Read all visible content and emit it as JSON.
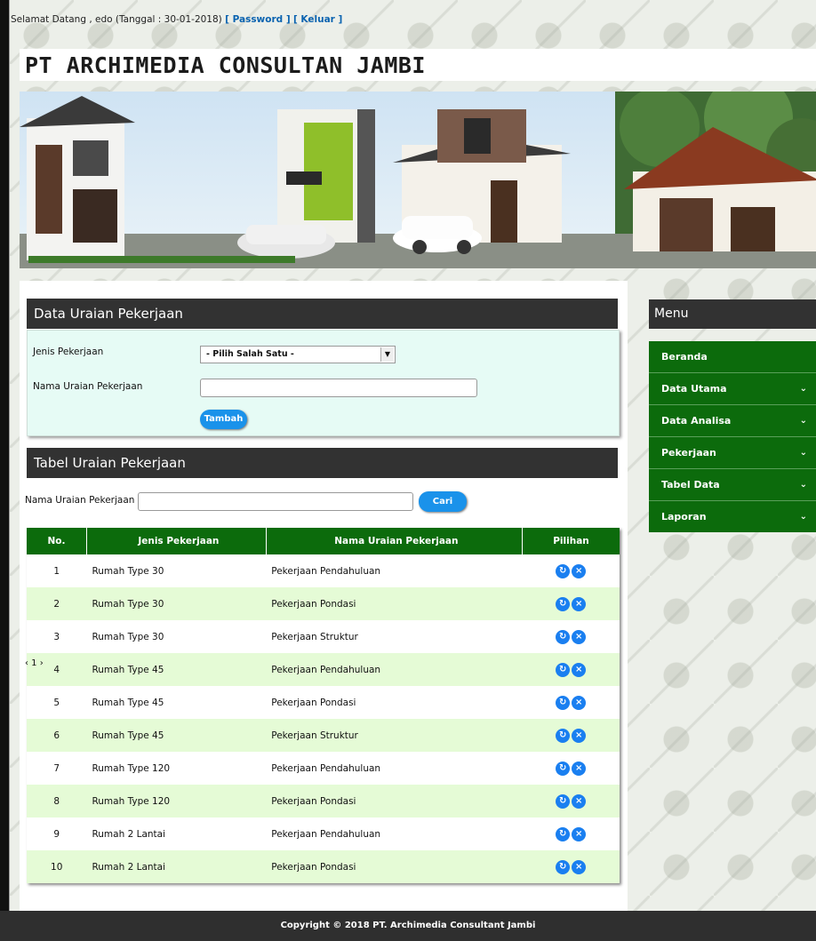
{
  "topbar": {
    "welcome": "Selamat Datang , edo (Tanggal : 30-01-2018)",
    "password_link": "[ Password ]",
    "logout_link": "[ Keluar ]"
  },
  "site_title": "PT ARCHIMEDIA CONSULTAN JAMBI",
  "form": {
    "heading": "Data Uraian Pekerjaan",
    "jenis_label": "Jenis Pekerjaan",
    "jenis_selected": "- Pilih Salah Satu -",
    "nama_label": "Nama Uraian Pekerjaan",
    "nama_value": "",
    "submit_label": "Tambah"
  },
  "table_section": {
    "heading": "Tabel Uraian Pekerjaan",
    "search_label": "Nama Uraian Pekerjaan :",
    "search_value": "",
    "search_button": "Cari",
    "columns": [
      "No.",
      "Jenis Pekerjaan",
      "Nama Uraian Pekerjaan",
      "Pilihan"
    ],
    "rows": [
      {
        "no": "1",
        "jenis": "Rumah Type 30",
        "nama": "Pekerjaan Pendahuluan"
      },
      {
        "no": "2",
        "jenis": "Rumah Type 30",
        "nama": "Pekerjaan Pondasi"
      },
      {
        "no": "3",
        "jenis": "Rumah Type 30",
        "nama": "Pekerjaan Struktur"
      },
      {
        "no": "4",
        "jenis": "Rumah Type 45",
        "nama": "Pekerjaan Pendahuluan"
      },
      {
        "no": "5",
        "jenis": "Rumah Type 45",
        "nama": "Pekerjaan Pondasi"
      },
      {
        "no": "6",
        "jenis": "Rumah Type 45",
        "nama": "Pekerjaan Struktur"
      },
      {
        "no": "7",
        "jenis": "Rumah Type 120",
        "nama": "Pekerjaan Pendahuluan"
      },
      {
        "no": "8",
        "jenis": "Rumah Type 120",
        "nama": "Pekerjaan Pondasi"
      },
      {
        "no": "9",
        "jenis": "Rumah 2 Lantai",
        "nama": "Pekerjaan Pendahuluan"
      },
      {
        "no": "10",
        "jenis": "Rumah 2 Lantai",
        "nama": "Pekerjaan Pondasi"
      }
    ],
    "pager": "‹ 1 ›"
  },
  "sidebar": {
    "heading": "Menu",
    "items": [
      {
        "label": "Beranda",
        "has_sub": false
      },
      {
        "label": "Data Utama",
        "has_sub": true
      },
      {
        "label": "Data Analisa",
        "has_sub": true
      },
      {
        "label": "Pekerjaan",
        "has_sub": true
      },
      {
        "label": "Tabel Data",
        "has_sub": true
      },
      {
        "label": "Laporan",
        "has_sub": true
      }
    ]
  },
  "icons": {
    "edit": "refresh-edit-icon",
    "delete": "close-delete-icon",
    "submenu": "chevron-down-icon"
  },
  "colors": {
    "menu_green": "#0c6b0c",
    "header_dark": "#323232",
    "button_blue": "#1a92ea",
    "row_alt": "#e5fbd6",
    "link_blue": "#0a63b0"
  },
  "footer": "Copyright © 2018 PT. Archimedia Consultant Jambi"
}
